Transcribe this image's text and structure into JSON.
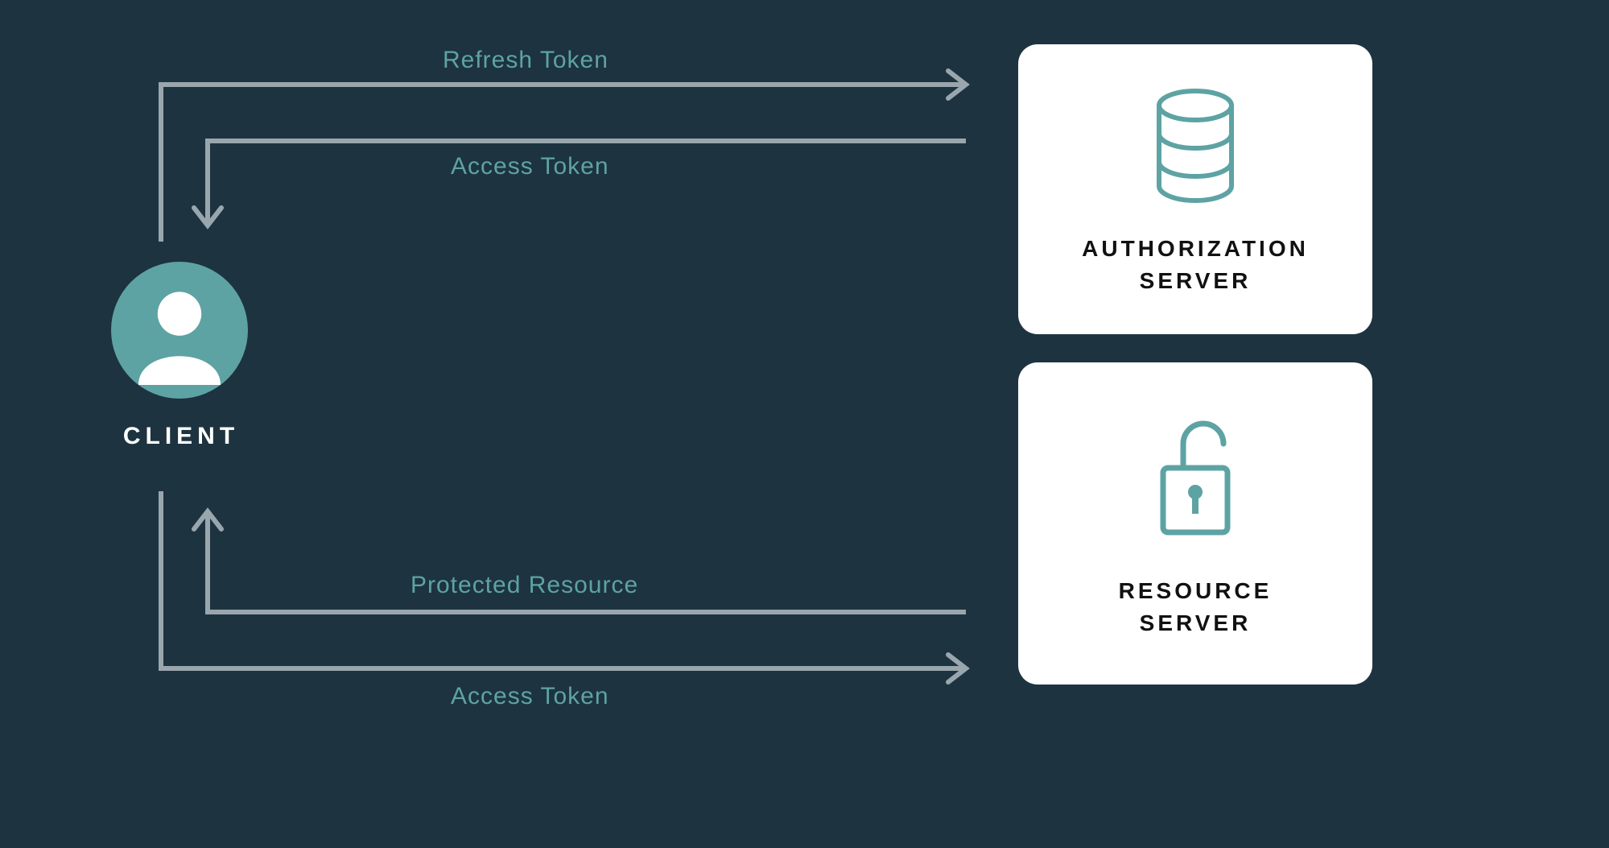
{
  "client": {
    "label": "CLIENT"
  },
  "servers": {
    "authorization": {
      "title_line1": "AUTHORIZATION",
      "title_line2": "SERVER"
    },
    "resource": {
      "title_line1": "RESOURCE",
      "title_line2": "SERVER"
    }
  },
  "flows": {
    "refresh_token": "Refresh Token",
    "access_token_auth": "Access Token",
    "protected_resource": "Protected Resource",
    "access_token_res": "Access Token"
  },
  "colors": {
    "background": "#1d3340",
    "accent": "#5ea3a3",
    "arrow": "#9aa6ad",
    "card_bg": "#ffffff",
    "text_light": "#ffffff",
    "text_dark": "#111111"
  },
  "icons": {
    "client": "user-circle-icon",
    "authorization_server": "database-icon",
    "resource_server": "unlock-icon"
  }
}
